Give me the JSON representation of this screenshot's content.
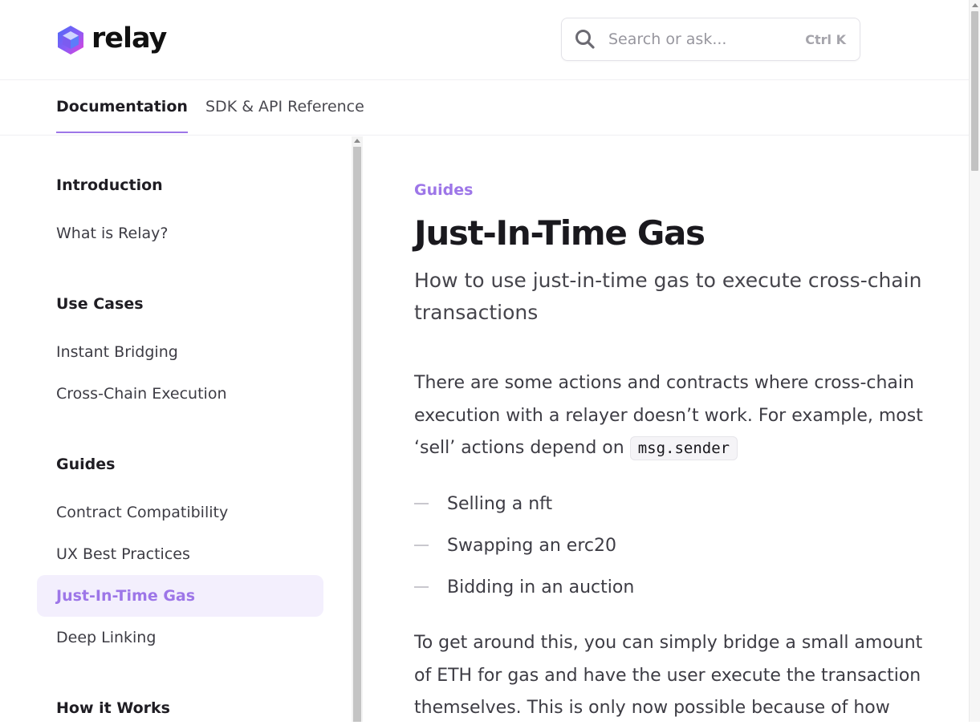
{
  "header": {
    "logo_text": "relay",
    "search": {
      "placeholder": "Search or ask...",
      "shortcut": "Ctrl K",
      "icon": "search-icon"
    }
  },
  "tabs": [
    {
      "label": "Documentation",
      "active": true
    },
    {
      "label": "SDK & API Reference",
      "active": false
    }
  ],
  "sidebar": {
    "sections": [
      {
        "heading": "Introduction",
        "items": [
          {
            "label": "What is Relay?"
          }
        ]
      },
      {
        "heading": "Use Cases",
        "items": [
          {
            "label": "Instant Bridging"
          },
          {
            "label": "Cross-Chain Execution"
          }
        ]
      },
      {
        "heading": "Guides",
        "items": [
          {
            "label": "Contract Compatibility"
          },
          {
            "label": "UX Best Practices"
          },
          {
            "label": "Just-In-Time Gas",
            "active": true
          },
          {
            "label": "Deep Linking"
          }
        ]
      },
      {
        "heading": "How it Works",
        "items": []
      }
    ]
  },
  "article": {
    "eyebrow": "Guides",
    "title": "Just-In-Time Gas",
    "subtitle": "How to use just-in-time gas to execute cross-chain transactions",
    "paragraph1_text": "There are some actions and contracts where cross-chain execution with a relayer doesn’t work. For example, most ‘sell’ actions depend on",
    "paragraph1_code": "msg.sender",
    "bullets": [
      "Selling a nft",
      "Swapping an erc20",
      "Bidding in an auction"
    ],
    "paragraph2": "To get around this, you can simply bridge a small amount of ETH for gas and have the user execute the transaction themselves. This is only now possible because of how"
  },
  "colors": {
    "accent": "#9d76e8",
    "active_background": "#f3effd",
    "text": "#1f1d23",
    "muted_text": "#3d3c44"
  }
}
